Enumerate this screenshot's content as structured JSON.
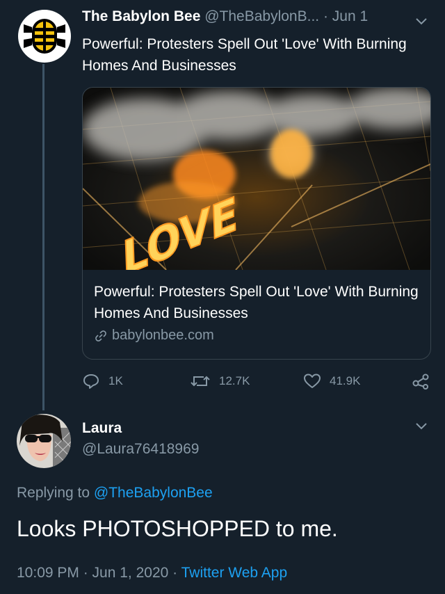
{
  "tweet": {
    "author_name": "The Babylon Bee",
    "author_handle": "@TheBabylonB...",
    "date": "· Jun 1",
    "text": "Powerful: Protesters Spell Out 'Love' With Burning Homes And Businesses",
    "avatar_icon": "babylon-bee-logo",
    "card": {
      "image_text": "LOVE",
      "title": "Powerful: Protesters Spell Out 'Love' With Burning Homes And Businesses",
      "domain": "babylonbee.com"
    },
    "actions": {
      "replies": "1K",
      "retweets": "12.7K",
      "likes": "41.9K"
    }
  },
  "reply": {
    "author_name": "Laura",
    "author_handle": "@Laura76418969",
    "replying_prefix": "Replying to",
    "replying_to": "@TheBabylonBee",
    "text": "Looks PHOTOSHOPPED to me.",
    "timestamp": "10:09 PM · Jun 1, 2020 ·",
    "source": "Twitter Web App"
  },
  "colors": {
    "background": "#15202b",
    "muted": "#8899a6",
    "accent": "#1da1f2",
    "border": "#38444d"
  }
}
